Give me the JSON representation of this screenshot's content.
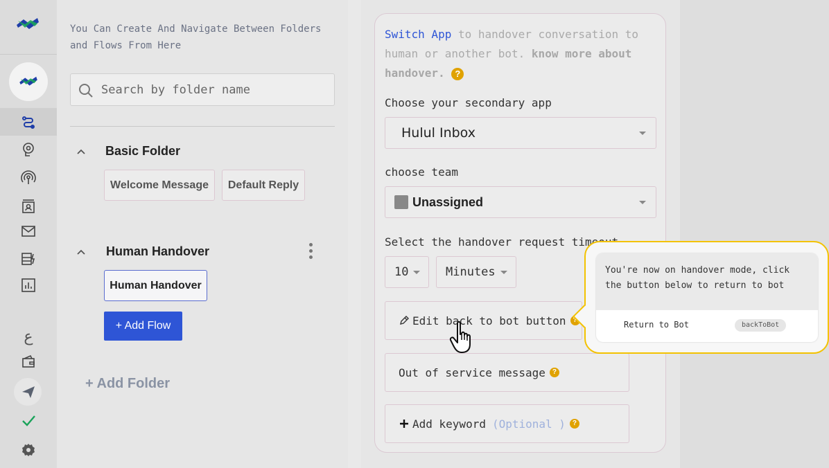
{
  "rail": {
    "icons": [
      "logo-icon",
      "flows-icon",
      "brain-gear-icon",
      "broadcast-icon",
      "contacts-icon",
      "mail-icon",
      "templates-icon",
      "analytics-icon",
      "arabic-language-icon",
      "wallet-icon",
      "send-icon",
      "check-icon",
      "settings-icon"
    ],
    "language_glyph": "ع",
    "accent": "#1aa35a"
  },
  "folders": {
    "intro": "You Can Create And Navigate Between Folders and Flows From Here",
    "search_placeholder": "Search by folder name",
    "groups": [
      {
        "title": "Basic Folder",
        "flows": [
          "Welcome Message",
          "Default Reply"
        ]
      },
      {
        "title": "Human Handover",
        "flows": [
          "Human Handover"
        ]
      }
    ],
    "add_flow": "+ Add Flow",
    "add_folder": "+ Add Folder"
  },
  "handover": {
    "link": "Switch App",
    "intro_rest": " to handover conversation to human or another bot. ",
    "know_more": "know more about handover.",
    "help": "?",
    "secondary_label": "Choose your secondary app",
    "secondary_value": "Hulul Inbox",
    "team_label": "choose team",
    "team_value": "Unassigned",
    "timeout_label": "Select the handover request timeout",
    "timeout_value": "10",
    "timeout_unit": "Minutes",
    "edit_back": "Edit back to bot button",
    "out_of_service": "Out of service message",
    "add_keyword": "Add keyword",
    "optional": "(Optional )"
  },
  "popup": {
    "message": "You're now on handover mode, click the button below to return to bot",
    "button_label": "Return to Bot",
    "payload": "backToBot",
    "border_color": "#f3c200"
  }
}
